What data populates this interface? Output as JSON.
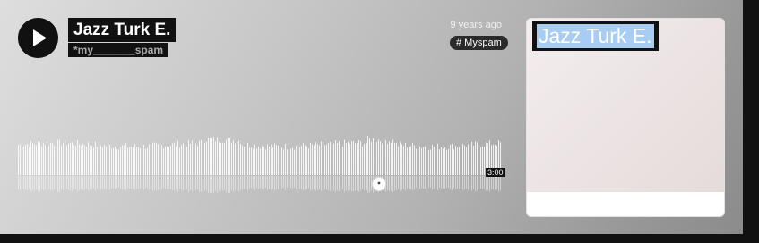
{
  "track": {
    "title": "Jazz Turk E.",
    "artist": "*my_______spam",
    "posted": "9 years ago",
    "tag": "# Myspam",
    "duration": "3:00"
  },
  "artwork": {
    "title": "Jazz Turk E."
  },
  "icons": {
    "play": "play-icon",
    "commenter_avatar": "avatar-icon"
  },
  "colors": {
    "panel_dark": "#111111",
    "waveform": "#ffffff",
    "highlight": "#a9cdf2"
  }
}
